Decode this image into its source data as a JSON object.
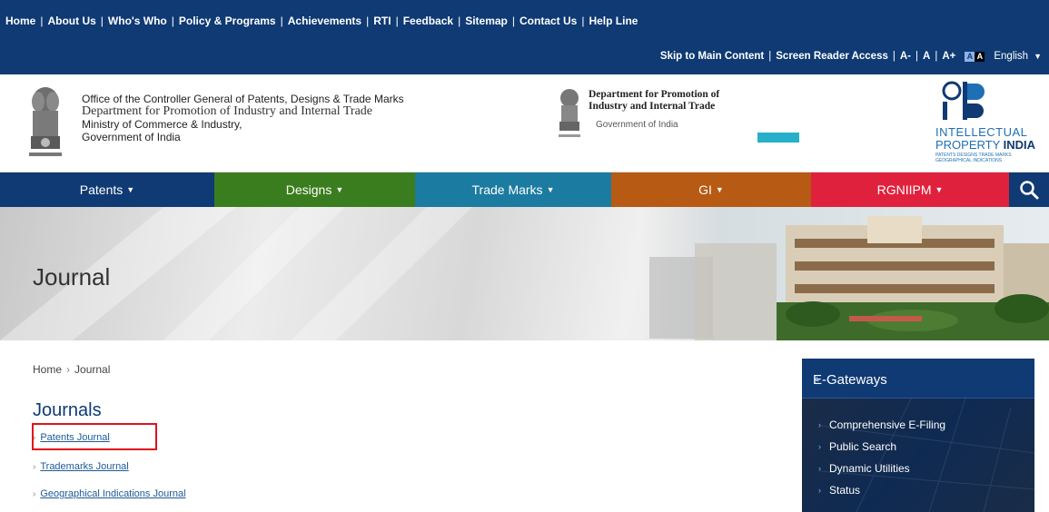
{
  "topbar": {
    "links": [
      "Home",
      "About Us",
      "Who's Who",
      "Policy & Programs",
      "Achievements",
      "RTI",
      "Feedback",
      "Sitemap",
      "Contact Us",
      "Help Line"
    ],
    "skip": "Skip to Main Content",
    "screen_reader": "Screen Reader Access",
    "font_small": "A-",
    "font_normal": "A",
    "font_large": "A+",
    "contrast_a": "A",
    "contrast_b": "A",
    "language": "English"
  },
  "header": {
    "office_line1": "Office of the Controller General of Patents, Designs & Trade Marks",
    "office_line2": "Department for Promotion of Industry and Internal Trade",
    "office_line3": "Ministry of Commerce & Industry,",
    "office_line4": "Government of India",
    "dipp_line1": "Department for Promotion of",
    "dipp_line2": "Industry and Internal Trade",
    "dipp_line3": "Government of India",
    "ipi_line1": "INTELLECTUAL",
    "ipi_line2a": "PROPERTY ",
    "ipi_line2b": "INDIA",
    "ipi_line3": "PATENTS DESIGNS TRADE MARKS GEOGRAPHICAL INDICATIONS"
  },
  "nav": {
    "items": [
      "Patents",
      "Designs",
      "Trade Marks",
      "GI",
      "RGNIIPM"
    ]
  },
  "banner": {
    "title": "Journal"
  },
  "breadcrumb": {
    "home": "Home",
    "current": "Journal"
  },
  "main": {
    "heading": "Journals",
    "links": [
      "Patents Journal",
      "Trademarks Journal",
      "Geographical Indications Journal"
    ]
  },
  "egateways": {
    "title": "E-Gateways",
    "items": [
      "Comprehensive E-Filing",
      "Public Search",
      "Dynamic Utilities",
      "Status"
    ]
  },
  "colors": {
    "primary": "#0f3a73",
    "designs": "#3a7d1e",
    "trademarks": "#1b7ba0",
    "gi": "#b75a14",
    "rgniipm": "#e0213e",
    "highlight": "#e0101c"
  }
}
